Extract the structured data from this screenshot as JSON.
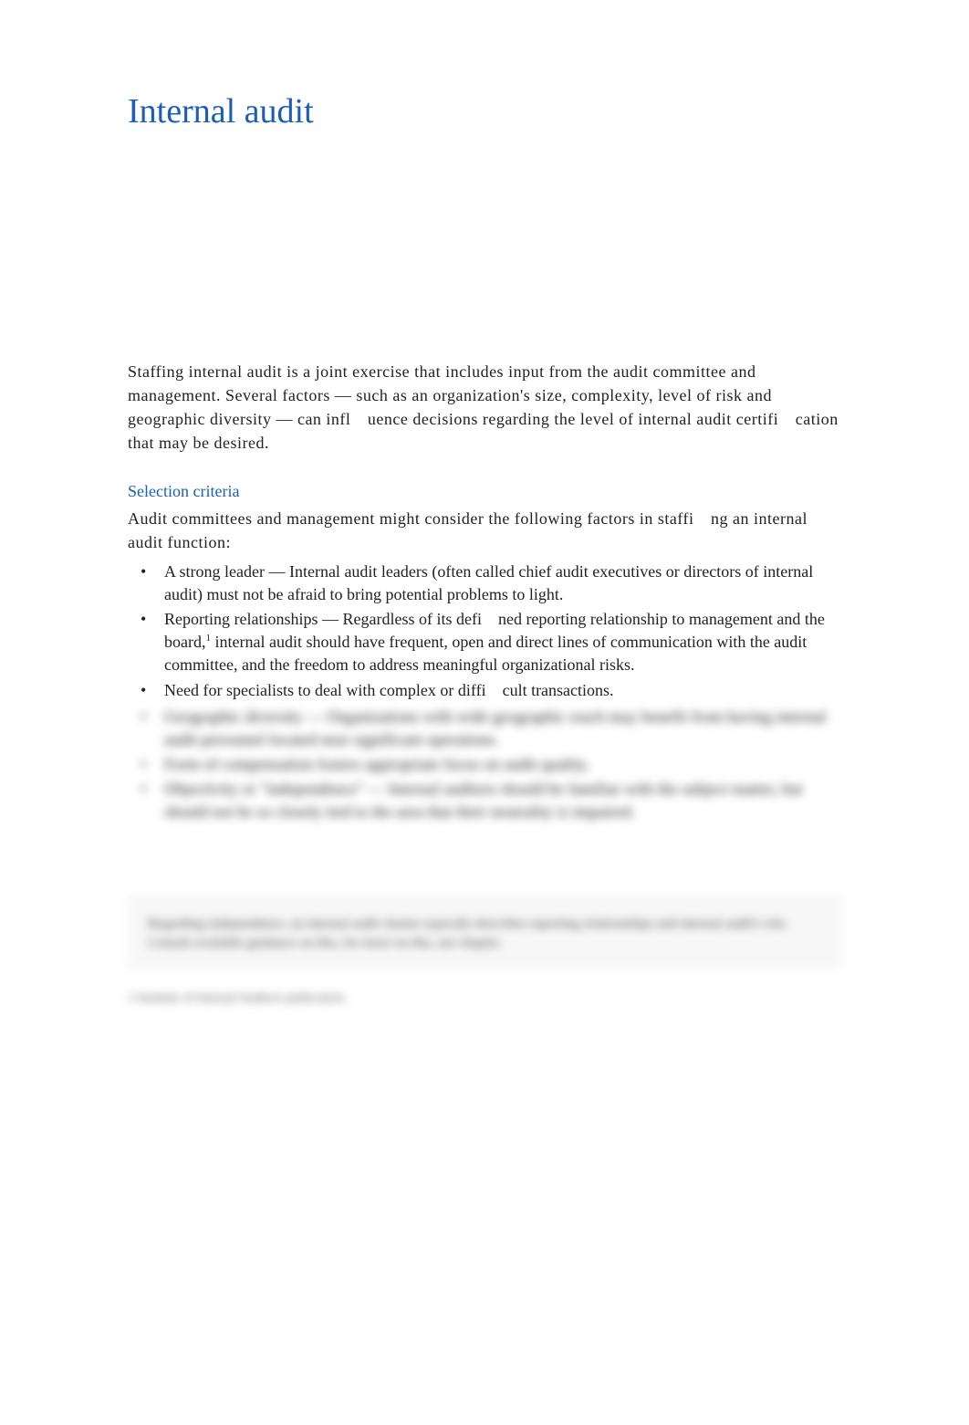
{
  "title": "Internal audit",
  "intro": "Staffing internal audit is a joint exercise that includes input from the audit committee and management. Several factors — such as an organization's size, complexity, level of risk and geographic diversity — can infl uence decisions regarding the level of internal audit certifi cation that may be desired.",
  "section": {
    "heading": "Selection criteria",
    "intro": "Audit committees and management might consider the following factors in staffi ng an internal audit function:",
    "bullets": [
      {
        "lead": "A strong leader",
        "rest": " — Internal audit leaders (often called chief audit executives or directors of internal audit) must not be afraid to bring potential problems to light."
      },
      {
        "lead": "Reporting relationships",
        "rest_before_sup": " — Regardless of its defi ned reporting relationship to management and the board,",
        "sup": "1",
        "rest_after_sup": " internal audit should have frequent, open and direct lines of communication with the audit committee, and the freedom to address meaningful organizational risks."
      },
      {
        "lead": "Need for specialists",
        "rest": " to deal with complex or diffi cult transactions."
      }
    ],
    "blurred_bullets": [
      {
        "lead": "Geographic diversity",
        "rest": " — Organizations with wide geographic reach may benefit from having internal audit personnel located near significant operations."
      },
      {
        "lead": "Form of compensation",
        "rest": " fosters appropriate focus on audit quality."
      },
      {
        "lead": "Objectivity or \"independence\"",
        "rest": " — Internal auditors should be familiar with the subject matter, but should not be so closely tied to the area that their neutrality is impaired."
      }
    ]
  },
  "footnote_box": "Regarding independence, an internal audit charter typically describes reporting relationships and internal audit's role. Consult available guidance on this, for more on this, see chapter.",
  "footnote_ref": "1 Institute of Internal Auditors publication."
}
